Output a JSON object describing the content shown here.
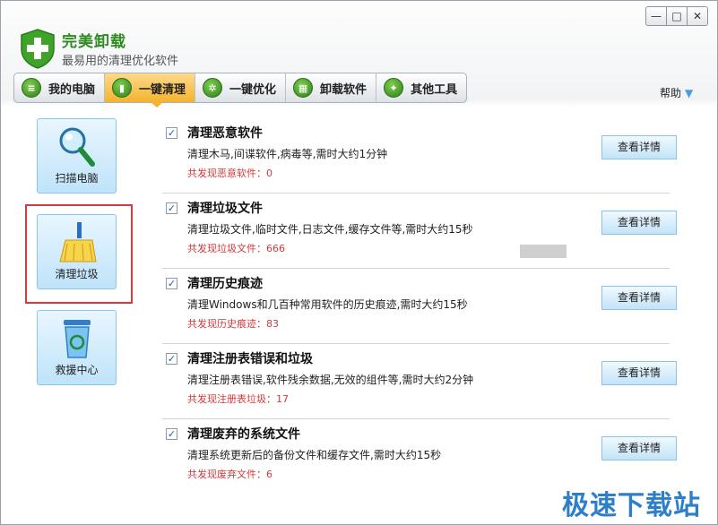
{
  "app": {
    "title": "完美卸载",
    "subtitle": "最易用的清理优化软件"
  },
  "window_controls": [
    "—",
    "□",
    "✕"
  ],
  "tabs": [
    {
      "label": "我的电脑",
      "icon": "computer-icon",
      "active": false
    },
    {
      "label": "一键清理",
      "icon": "trash-icon",
      "active": true
    },
    {
      "label": "一键优化",
      "icon": "gear-icon",
      "active": false
    },
    {
      "label": "卸载软件",
      "icon": "uninstall-icon",
      "active": false
    },
    {
      "label": "其他工具",
      "icon": "tools-icon",
      "active": false
    }
  ],
  "help": {
    "label": "帮助"
  },
  "sidebar": {
    "items": [
      {
        "label": "扫描电脑",
        "icon": "magnifier-icon",
        "selected": false
      },
      {
        "label": "清理垃圾",
        "icon": "broom-icon",
        "selected": true
      },
      {
        "label": "救援中心",
        "icon": "recycle-bin-icon",
        "selected": false
      }
    ]
  },
  "items": [
    {
      "title": "清理恶意软件",
      "desc": "清理木马,间谍软件,病毒等,需时大约1分钟",
      "found": "共发现恶意软件：0",
      "checked": true,
      "button": "查看详情"
    },
    {
      "title": "清理垃圾文件",
      "desc": "清理垃圾文件,临时文件,日志文件,缓存文件等,需时大约15秒",
      "found": "共发现垃圾文件：666",
      "checked": true,
      "button": "查看详情"
    },
    {
      "title": "清理历史痕迹",
      "desc": "清理Windows和几百种常用软件的历史痕迹,需时大约15秒",
      "found": "共发现历史痕迹：83",
      "checked": true,
      "button": "查看详情"
    },
    {
      "title": "清理注册表错误和垃圾",
      "desc": "清理注册表错误,软件残余数据,无效的组件等,需时大约2分钟",
      "found": "共发现注册表垃圾：17",
      "checked": true,
      "button": "查看详情"
    },
    {
      "title": "清理废弃的系统文件",
      "desc": "清理系统更新后的备份文件和缓存文件,需时大约15秒",
      "found": "共发现废弃文件：6",
      "checked": true,
      "button": "查看详情"
    }
  ],
  "watermark": "极速下载站",
  "colors": {
    "accent_green": "#2e8b20",
    "active_tab": "#f4b32e",
    "found_red": "#d13a3a",
    "highlight_red": "#d9383d"
  }
}
